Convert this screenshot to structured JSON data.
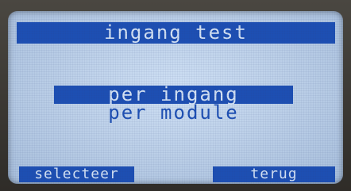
{
  "screen": {
    "title": "ingang test",
    "menu": {
      "items": [
        {
          "label": "per ingang",
          "selected": true
        },
        {
          "label": "per module",
          "selected": false
        }
      ]
    },
    "softkeys": {
      "left": "selecteer",
      "right": "terug"
    }
  },
  "colors": {
    "lcd_background": "#bcd0e8",
    "lcd_foreground": "#1d4fb3"
  }
}
